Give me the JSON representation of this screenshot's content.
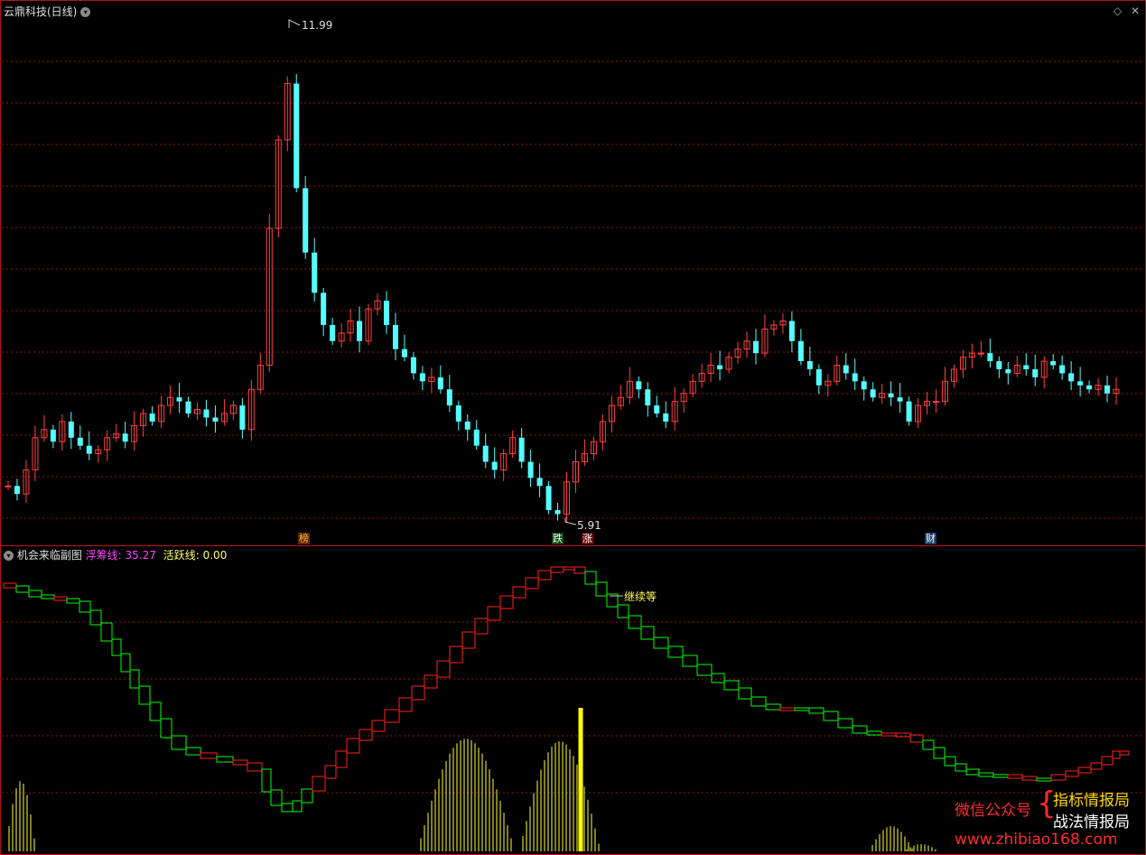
{
  "main_panel": {
    "title": "云鼎科技(日线)",
    "high_label": "11.99",
    "low_label": "5.91",
    "markers": [
      {
        "text": "榜",
        "bg": "#5a2a00",
        "color": "#ffb040"
      },
      {
        "text": "跌",
        "bg": "#0d4a0d",
        "color": "#ffffff"
      },
      {
        "text": "涨",
        "bg": "#6a0a0a",
        "color": "#ffffff"
      },
      {
        "text": "财",
        "bg": "#1a3a6a",
        "color": "#ffffff"
      }
    ]
  },
  "sub_panel": {
    "title": "机会来临副图",
    "float_label": "浮筹线:",
    "float_value": "35.27",
    "active_label": "活跃线:",
    "active_value": "0.00",
    "annotation": "继续等"
  },
  "watermark": {
    "wechat": "微信公众号",
    "brace": "{",
    "name1": "指标情报局",
    "name2": "战法情报局",
    "url": "www.zhibiao168.com"
  },
  "colors": {
    "up": "#ff4040",
    "down": "#54ffff",
    "grid": "#8b1a1a",
    "green": "#00ff00",
    "red": "#ff2020",
    "yellow": "#ffff33"
  },
  "icons": [
    "chevron-down-icon",
    "diamond-icon",
    "close-icon"
  ]
}
